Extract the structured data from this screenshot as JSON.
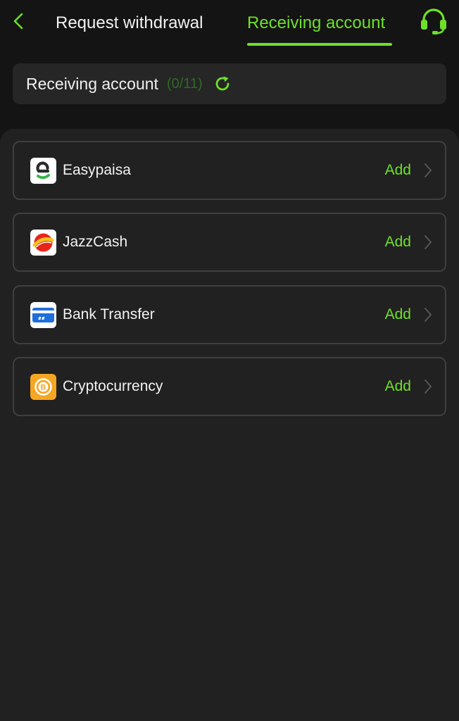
{
  "header": {
    "back_icon": "chevron-left-icon",
    "tabs": [
      {
        "label": "Request withdrawal",
        "active": false
      },
      {
        "label": "Receiving account",
        "active": true
      }
    ],
    "support_icon": "headset-icon"
  },
  "summary": {
    "title": "Receiving account",
    "count": "(0/11)",
    "refresh_icon": "refresh-icon"
  },
  "accounts": [
    {
      "name": "Easypaisa",
      "action": "Add",
      "icon": "easypaisa-logo-icon"
    },
    {
      "name": "JazzCash",
      "action": "Add",
      "icon": "jazzcash-logo-icon"
    },
    {
      "name": "Bank Transfer",
      "action": "Add",
      "icon": "bank-card-icon"
    },
    {
      "name": "Cryptocurrency",
      "action": "Add",
      "icon": "bitcoin-coin-icon"
    }
  ],
  "colors": {
    "accent": "#6ee02a",
    "background": "#141414",
    "panel": "#212121",
    "card_border": "#3f3f3f"
  }
}
